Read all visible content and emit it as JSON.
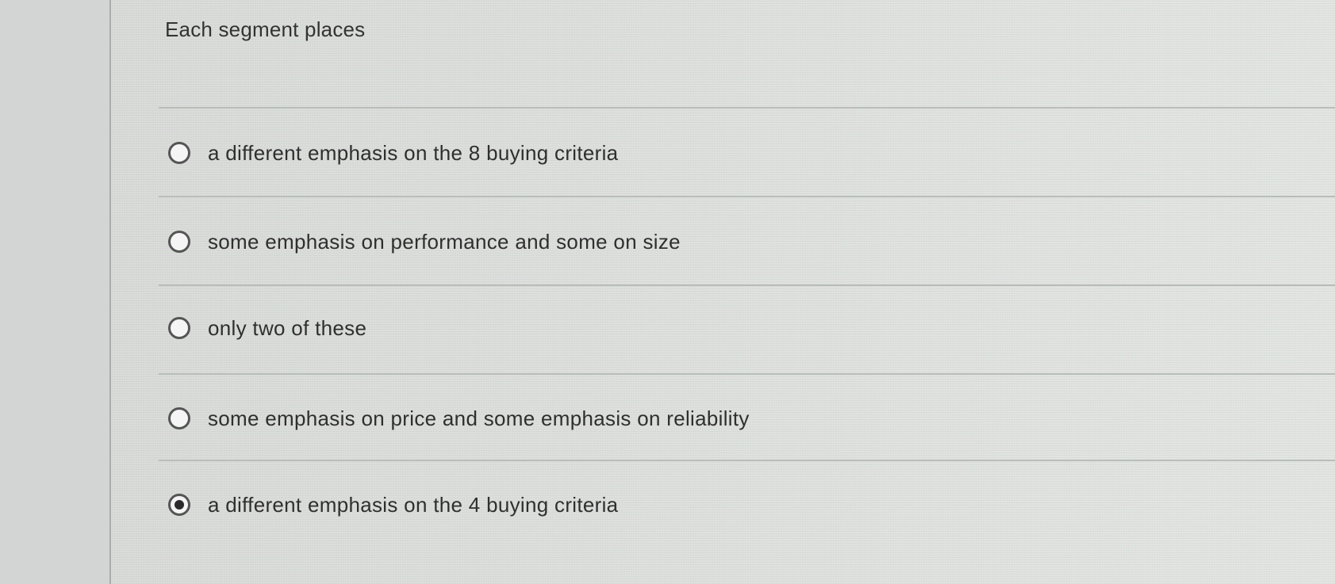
{
  "question": {
    "text": "Each segment places"
  },
  "options": [
    {
      "label": "a different emphasis on the 8 buying criteria",
      "selected": false
    },
    {
      "label": "some emphasis on performance and some on size",
      "selected": false
    },
    {
      "label": "only two of these",
      "selected": false
    },
    {
      "label": "some emphasis on price and some emphasis on reliability",
      "selected": false
    },
    {
      "label": "a different emphasis on the 4 buying criteria",
      "selected": true
    }
  ]
}
